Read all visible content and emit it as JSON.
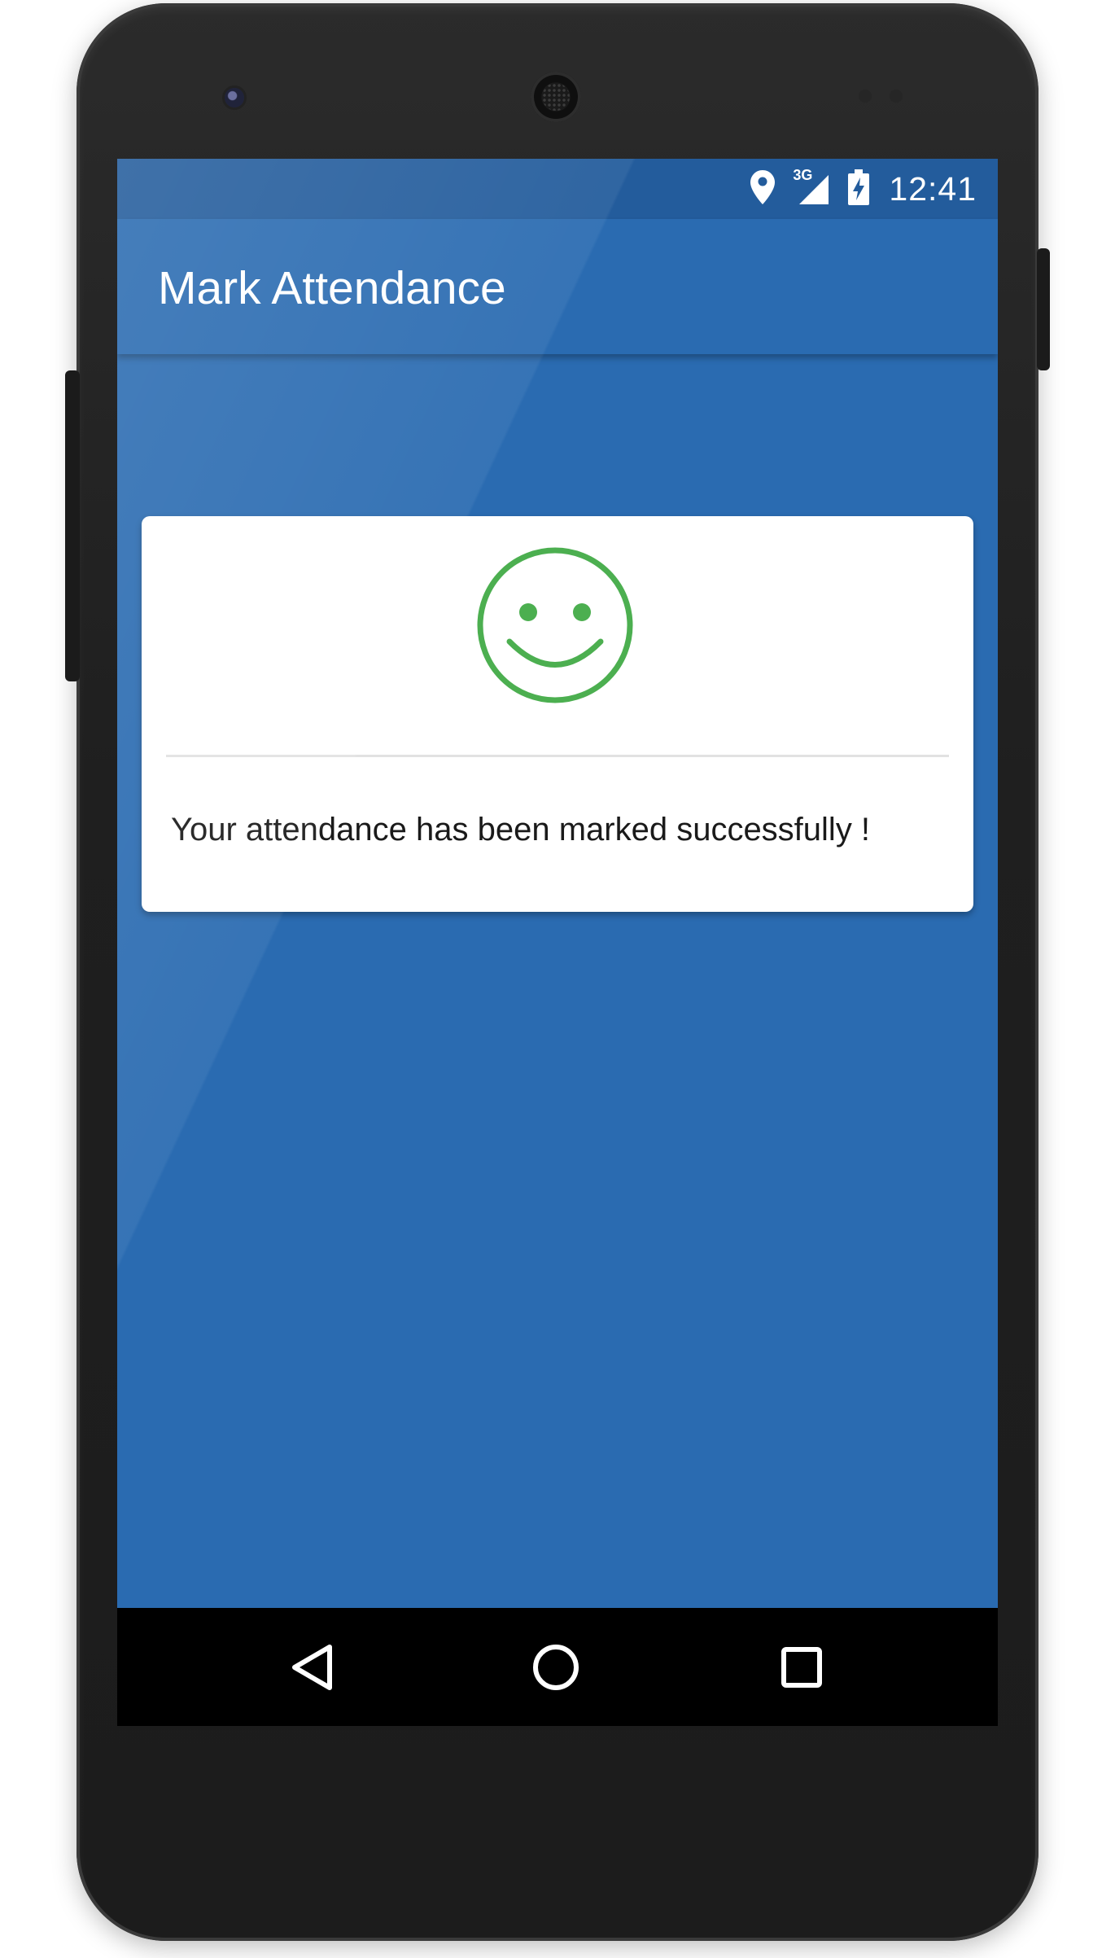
{
  "status_bar": {
    "time": "12:41",
    "network_label": "3G",
    "icons": [
      "location-icon",
      "signal-icon",
      "battery-charging-icon"
    ]
  },
  "app_bar": {
    "title": "Mark Attendance"
  },
  "card": {
    "icon": "smiley-icon",
    "message": "Your attendance has been marked successfully !"
  },
  "nav_bar": {
    "icons": [
      "back-icon",
      "home-icon",
      "recents-icon"
    ]
  },
  "colors": {
    "primary": "#2a6bb1",
    "status_bar": "#235c9c",
    "success_green": "#4caf50",
    "card_bg": "#ffffff",
    "nav_bar": "#000000"
  }
}
